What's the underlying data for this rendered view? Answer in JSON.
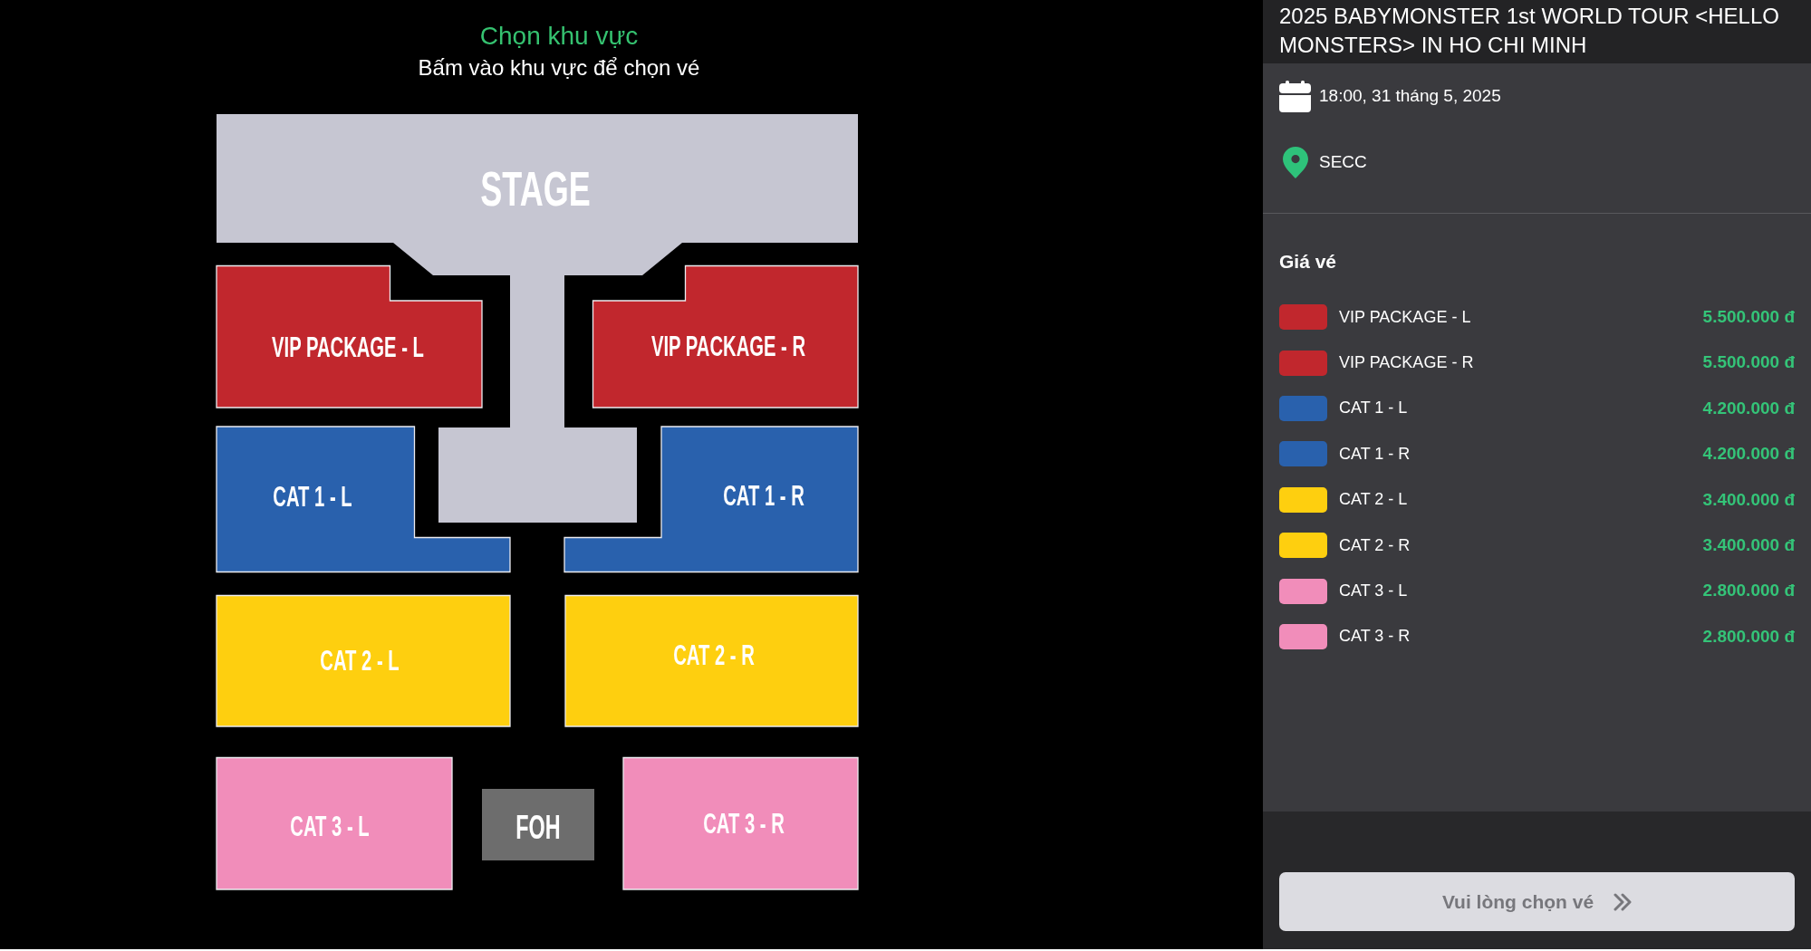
{
  "seat_map": {
    "title": "Chọn khu vực",
    "subtitle": "Bấm vào khu vực để chọn vé",
    "areas": [
      {
        "kind": "stage",
        "label": "STAGE",
        "color": "#c6c6d2"
      },
      {
        "kind": "zone",
        "label": "VIP PACKAGE - L",
        "color": "#c1272d"
      },
      {
        "kind": "zone",
        "label": "VIP PACKAGE - R",
        "color": "#c1272d"
      },
      {
        "kind": "zone",
        "label": "CAT 1 - L",
        "color": "#2961ad"
      },
      {
        "kind": "zone",
        "label": "CAT 1 - R",
        "color": "#2961ad"
      },
      {
        "kind": "zone",
        "label": "CAT 2 - L",
        "color": "#fecf0f"
      },
      {
        "kind": "zone",
        "label": "CAT 2 - R",
        "color": "#fecf0f"
      },
      {
        "kind": "zone",
        "label": "CAT 3 - L",
        "color": "#f18dba"
      },
      {
        "kind": "foh",
        "label": "FOH",
        "color": "#6d6d6d"
      },
      {
        "kind": "zone",
        "label": "CAT 3 - R",
        "color": "#f18dba"
      }
    ]
  },
  "event": {
    "title": "2025 BABYMONSTER 1st WORLD TOUR <HELLO MONSTERS> IN HO CHI MINH",
    "date": "18:00, 31 tháng 5, 2025",
    "venue": "SECC"
  },
  "prices": {
    "heading": "Giá vé",
    "items": [
      {
        "name": "VIP PACKAGE - L",
        "price": "5.500.000 đ",
        "color": "#c1272d"
      },
      {
        "name": "VIP PACKAGE - R",
        "price": "5.500.000 đ",
        "color": "#c1272d"
      },
      {
        "name": "CAT 1 - L",
        "price": "4.200.000 đ",
        "color": "#2961ad"
      },
      {
        "name": "CAT 1 - R",
        "price": "4.200.000 đ",
        "color": "#2961ad"
      },
      {
        "name": "CAT 2 - L",
        "price": "3.400.000 đ",
        "color": "#fecf0f"
      },
      {
        "name": "CAT 2 - R",
        "price": "3.400.000 đ",
        "color": "#fecf0f"
      },
      {
        "name": "CAT 3 - L",
        "price": "2.800.000 đ",
        "color": "#f18dba"
      },
      {
        "name": "CAT 3 - R",
        "price": "2.800.000 đ",
        "color": "#f18dba"
      }
    ]
  },
  "continue_button": {
    "label": "Vui lòng chọn vé",
    "disabled": true
  }
}
